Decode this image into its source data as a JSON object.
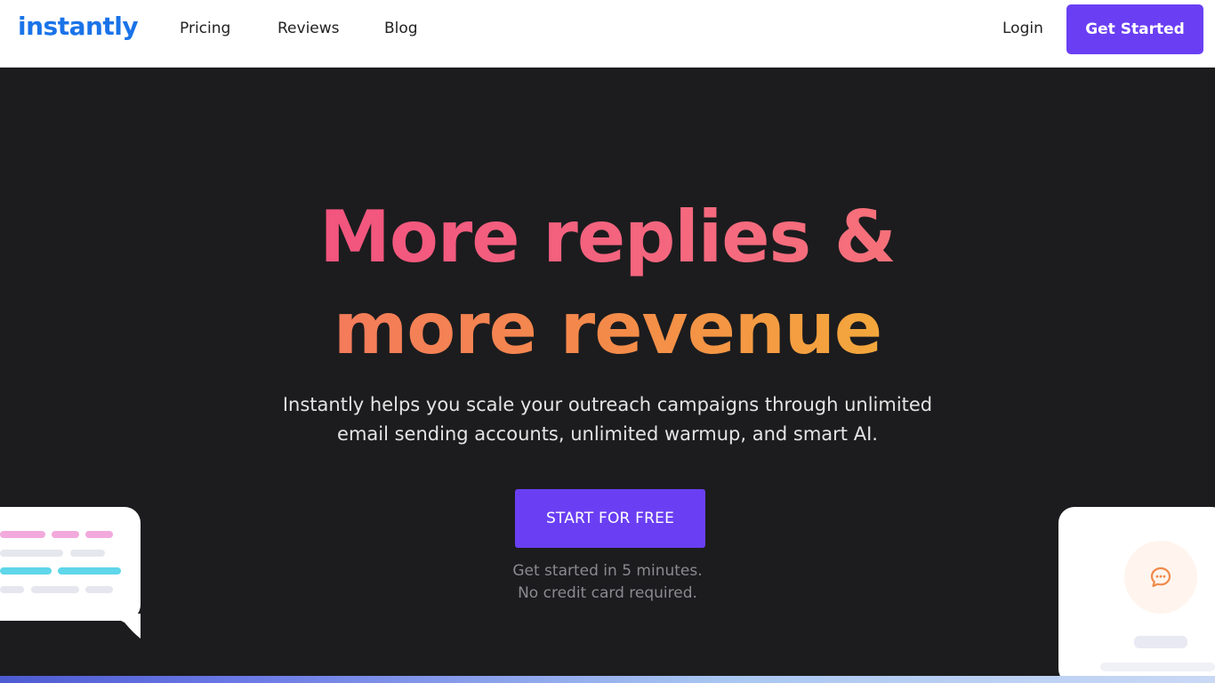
{
  "nav": {
    "logo": "instantly",
    "links": [
      "Pricing",
      "Reviews",
      "Blog"
    ],
    "login": "Login",
    "cta": "Get Started"
  },
  "hero": {
    "title_line1": "More replies &",
    "title_line2": "more revenue",
    "subtitle_line1": "Instantly helps you scale your outreach campaigns through unlimited",
    "subtitle_line2": "email sending accounts, unlimited warmup, and smart AI.",
    "cta": "START FOR FREE",
    "note_line1": "Get started in 5 minutes.",
    "note_line2": "No credit card required."
  },
  "colors": {
    "brand_purple": "#6a3ff3",
    "logo_blue": "#1a73e8",
    "background": "#1c1c1e"
  },
  "icons": {
    "chat": "chat-bubble-icon"
  }
}
